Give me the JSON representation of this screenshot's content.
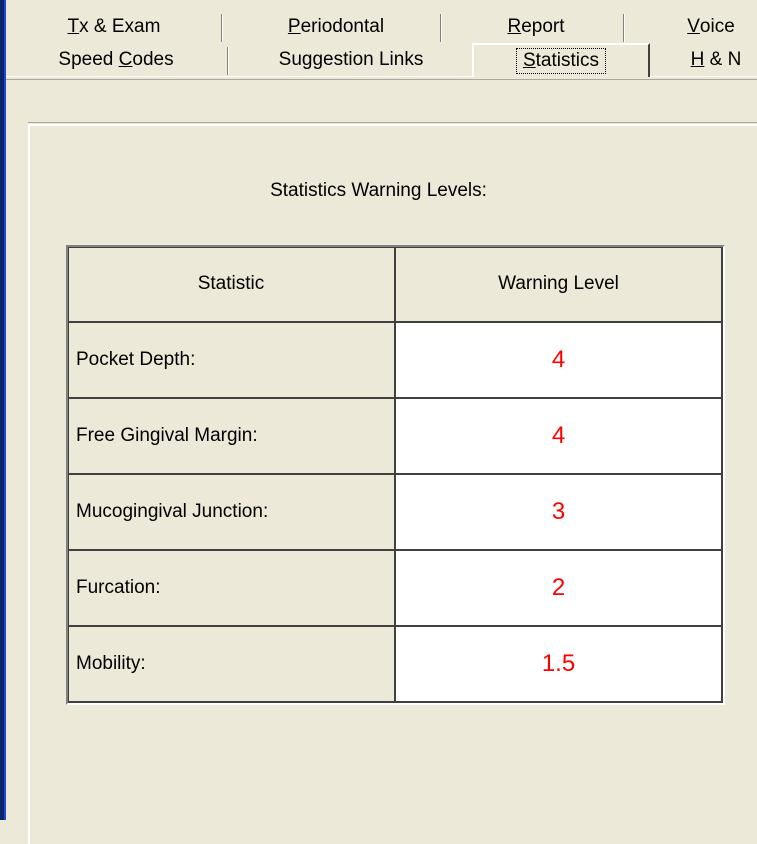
{
  "tabs": {
    "row1": [
      {
        "prefix": "",
        "mnemonic": "T",
        "suffix": "x & Exam"
      },
      {
        "prefix": "",
        "mnemonic": "P",
        "suffix": "eriodontal"
      },
      {
        "prefix": "",
        "mnemonic": "R",
        "suffix": "eport"
      },
      {
        "prefix": "",
        "mnemonic": "V",
        "suffix": "oice"
      }
    ],
    "row2": [
      {
        "prefix": "Speed ",
        "mnemonic": "C",
        "suffix": "odes"
      },
      {
        "prefix": "Suggestion Links",
        "mnemonic": "",
        "suffix": ""
      },
      {
        "prefix": "",
        "mnemonic": "S",
        "suffix": "tatistics"
      },
      {
        "prefix": "",
        "mnemonic": "H",
        "suffix": " & N"
      }
    ],
    "selected": "Statistics"
  },
  "panel": {
    "caption": "Statistics Warning Levels:",
    "table": {
      "headers": [
        "Statistic",
        "Warning Level"
      ],
      "rows": [
        {
          "label": "Pocket Depth:",
          "value": "4"
        },
        {
          "label": "Free Gingival Margin:",
          "value": "4"
        },
        {
          "label": "Mucogingival Junction:",
          "value": "3"
        },
        {
          "label": "Furcation:",
          "value": "2"
        },
        {
          "label": "Mobility:",
          "value": "1.5"
        }
      ]
    }
  },
  "colors": {
    "value_text": "#ff0000",
    "face": "#ece9d8",
    "frame": "#0a246a"
  }
}
